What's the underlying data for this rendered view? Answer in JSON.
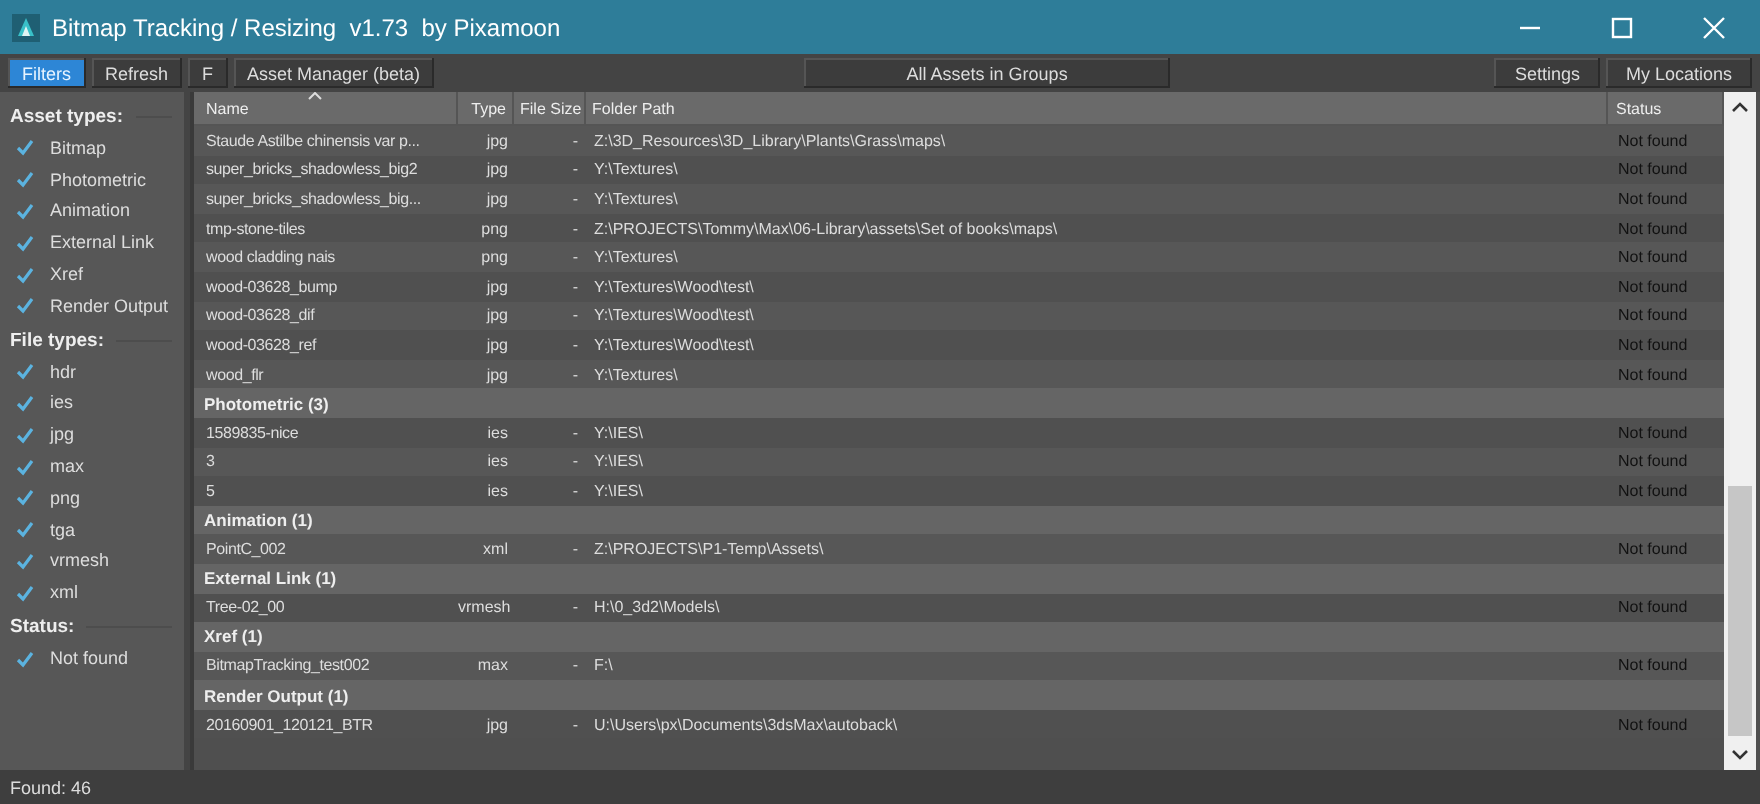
{
  "window": {
    "title": "Bitmap Tracking / Resizing  v1.73  by Pixamoon"
  },
  "toolbar": {
    "left": [
      {
        "label": "Filters",
        "selected": true
      },
      {
        "label": "Refresh",
        "selected": false
      },
      {
        "label": "F",
        "selected": false
      },
      {
        "label": "Asset Manager (beta)",
        "selected": false
      }
    ],
    "center": [
      {
        "label": "All Assets in Groups",
        "selected": false
      }
    ],
    "right": [
      {
        "label": "Settings",
        "selected": false
      },
      {
        "label": "My Locations",
        "selected": false
      }
    ]
  },
  "sidebar": {
    "sections": [
      {
        "title": "Asset types:",
        "items": [
          {
            "label": "Bitmap",
            "checked": true
          },
          {
            "label": "Photometric",
            "checked": true
          },
          {
            "label": "Animation",
            "checked": true
          },
          {
            "label": "External Link",
            "checked": true
          },
          {
            "label": "Xref",
            "checked": true
          },
          {
            "label": "Render Output",
            "checked": true
          }
        ]
      },
      {
        "title": "File types:",
        "items": [
          {
            "label": "hdr",
            "checked": true
          },
          {
            "label": "ies",
            "checked": true
          },
          {
            "label": "jpg",
            "checked": true
          },
          {
            "label": "max",
            "checked": true
          },
          {
            "label": "png",
            "checked": true
          },
          {
            "label": "tga",
            "checked": true
          },
          {
            "label": "vrmesh",
            "checked": true
          },
          {
            "label": "xml",
            "checked": true
          }
        ]
      },
      {
        "title": "Status:",
        "items": [
          {
            "label": "Not found",
            "checked": true
          }
        ]
      }
    ]
  },
  "table": {
    "columns": [
      "Name",
      "Type",
      "File Size",
      "Folder Path",
      "Status"
    ],
    "rows": [
      {
        "kind": "item",
        "cells": [
          "Staude Astilbe chinensis var p...",
          "jpg",
          "-",
          "Z:\\3D_Resources\\3D_Library\\Plants\\Grass\\maps\\",
          "Not found"
        ]
      },
      {
        "kind": "item",
        "cells": [
          "super_bricks_shadowless_big2",
          "jpg",
          "-",
          "Y:\\Textures\\",
          "Not found"
        ]
      },
      {
        "kind": "item",
        "cells": [
          "super_bricks_shadowless_big...",
          "jpg",
          "-",
          "Y:\\Textures\\",
          "Not found"
        ]
      },
      {
        "kind": "item",
        "cells": [
          "tmp-stone-tiles",
          "png",
          "-",
          "Z:\\PROJECTS\\Tommy\\Max\\06-Library\\assets\\Set of  books\\maps\\",
          "Not found"
        ]
      },
      {
        "kind": "item",
        "cells": [
          "wood cladding nais",
          "png",
          "-",
          "Y:\\Textures\\",
          "Not found"
        ]
      },
      {
        "kind": "item",
        "cells": [
          "wood-03628_bump",
          "jpg",
          "-",
          "Y:\\Textures\\Wood\\test\\",
          "Not found"
        ]
      },
      {
        "kind": "item",
        "cells": [
          "wood-03628_dif",
          "jpg",
          "-",
          "Y:\\Textures\\Wood\\test\\",
          "Not found"
        ]
      },
      {
        "kind": "item",
        "cells": [
          "wood-03628_ref",
          "jpg",
          "-",
          "Y:\\Textures\\Wood\\test\\",
          "Not found"
        ]
      },
      {
        "kind": "item",
        "cells": [
          "wood_flr",
          "jpg",
          "-",
          "Y:\\Textures\\",
          "Not found"
        ]
      },
      {
        "kind": "group",
        "label": "Photometric (3)"
      },
      {
        "kind": "item",
        "cells": [
          "1589835-nice",
          "ies",
          "-",
          "Y:\\IES\\",
          "Not found"
        ]
      },
      {
        "kind": "item",
        "cells": [
          "3",
          "ies",
          "-",
          "Y:\\IES\\",
          "Not found"
        ]
      },
      {
        "kind": "item",
        "cells": [
          "5",
          "ies",
          "-",
          "Y:\\IES\\",
          "Not found"
        ]
      },
      {
        "kind": "group",
        "label": "Animation (1)"
      },
      {
        "kind": "item",
        "cells": [
          "PointC_002",
          "xml",
          "-",
          "Z:\\PROJECTS\\P1-Temp\\Assets\\",
          "Not found"
        ]
      },
      {
        "kind": "group",
        "label": "External Link (1)"
      },
      {
        "kind": "item",
        "cells": [
          "Tree-02_00",
          "vrmesh",
          "-",
          "H:\\0_3d2\\Models\\",
          "Not found"
        ]
      },
      {
        "kind": "group",
        "label": "Xref (1)"
      },
      {
        "kind": "item",
        "cells": [
          "BitmapTracking_test002",
          "max",
          "-",
          "F:\\",
          "Not found"
        ]
      },
      {
        "kind": "group",
        "label": "Render Output (1)"
      },
      {
        "kind": "item",
        "cells": [
          "20160901_120121_BTR",
          "jpg",
          "-",
          "U:\\Users\\px\\Documents\\3dsMax\\autoback\\",
          "Not found"
        ]
      }
    ]
  },
  "status_bar": "Found: 46"
}
